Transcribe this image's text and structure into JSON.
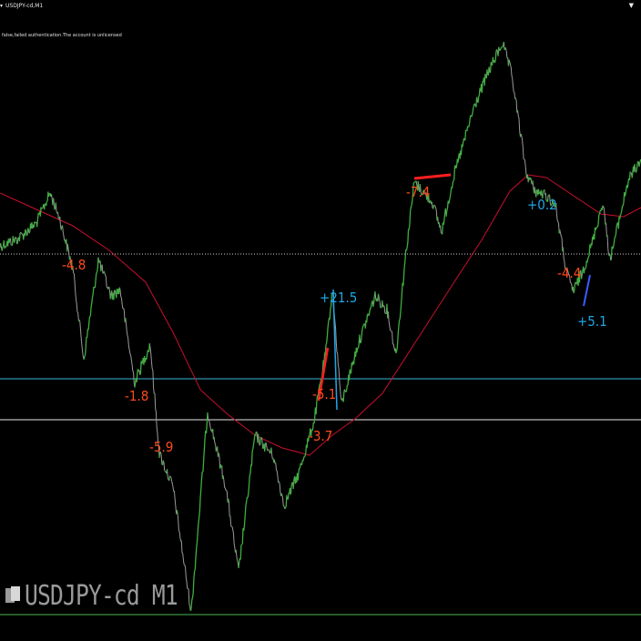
{
  "window": {
    "tab_label": "USDJPY-cd,M1",
    "status_message": "false,failed authentication.The account is unlicensed",
    "watermark": "USDJPY-cd M1"
  },
  "colors": {
    "background": "#000000",
    "price_up": "#3fae3f",
    "price_down": "#9a9a9a",
    "moving_average": "#c8102e",
    "trade_loss": "#ff4a1a",
    "trade_profit": "#1ea7e8",
    "level_dotted": "#d0d0d0",
    "level_cyan": "#3bb6d6",
    "level_white": "#e6e6e6",
    "level_green": "#4db84d"
  },
  "chart_data": {
    "type": "line",
    "symbol": "USDJPY-cd",
    "timeframe": "M1",
    "trade_labels": [
      {
        "text": "-4.8",
        "kind": "loss"
      },
      {
        "text": "-1.8",
        "kind": "loss"
      },
      {
        "text": "-5.9",
        "kind": "loss"
      },
      {
        "text": "-3.7",
        "kind": "loss"
      },
      {
        "text": "-5.1",
        "kind": "loss"
      },
      {
        "text": "+21.5",
        "kind": "profit"
      },
      {
        "text": "-7.4",
        "kind": "loss"
      },
      {
        "text": "+0.2",
        "kind": "profit"
      },
      {
        "text": "-4.4",
        "kind": "loss"
      },
      {
        "text": "+5.1",
        "kind": "profit"
      }
    ],
    "horizontal_levels": [
      {
        "name": "dotted-level",
        "style": "dotted"
      },
      {
        "name": "cyan-level",
        "style": "solid"
      },
      {
        "name": "white-level",
        "style": "solid"
      },
      {
        "name": "green-level",
        "style": "solid"
      }
    ],
    "grid": false
  }
}
